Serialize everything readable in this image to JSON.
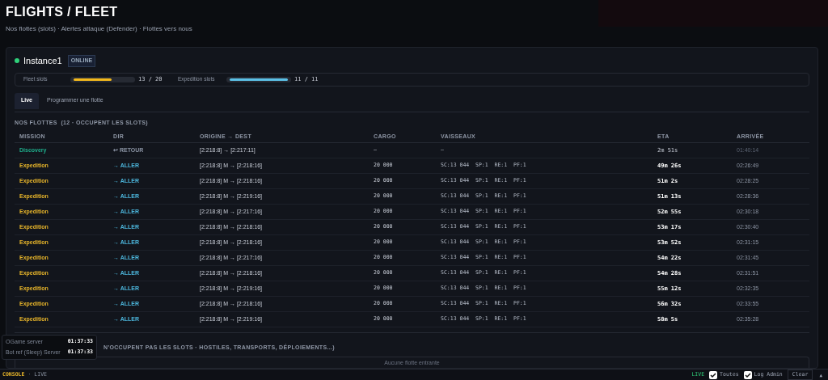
{
  "page": {
    "title": "FLIGHTS / FLEET",
    "subtitle": "Nos flottes (slots) · Alertes attaque (Defender) · Flottes vers nous"
  },
  "instance": {
    "name": "Instance1",
    "status": "ONLINE",
    "online": true
  },
  "slots": [
    {
      "label": "Fleet slots",
      "level": 0.65,
      "reading": "13 / 20",
      "kind": "fleet"
    },
    {
      "label": "Expedition slots",
      "level": 1,
      "reading": "11 / 11",
      "kind": "expedition"
    }
  ],
  "tabs": [
    {
      "label": "Live",
      "selected": true
    },
    {
      "label": "Programmer une flotte",
      "selected": false
    }
  ],
  "fleets": {
    "heading": "NOS FLOTTES  (12 · OCCUPENT LES SLOTS)",
    "columns": [
      "MISSION",
      "DIR",
      "ORIGINE → DEST",
      "CARGO",
      "VAISSEAUX",
      "ETA",
      "ARRIVÉE"
    ],
    "rows": [
      {
        "kind": "discovery",
        "mission": "Discovery",
        "dir": "↩ RETOUR",
        "route": "[2:218:8] → [2:217:11]",
        "cargo": "—",
        "ships": "—",
        "eta": "2m 51s",
        "arrival": "01:40:14"
      },
      {
        "kind": "expedition",
        "mission": "Expedition",
        "dir": "→ ALLER",
        "route": "[2:218:8] M → [2:218:16]",
        "cargo": "20 000",
        "ships": "SC:13 044  SP:1  RE:1  PF:1",
        "eta": "49m 26s",
        "arrival": "02:26:49"
      },
      {
        "kind": "expedition",
        "mission": "Expedition",
        "dir": "→ ALLER",
        "route": "[2:218:8] M → [2:218:16]",
        "cargo": "20 000",
        "ships": "SC:13 044  SP:1  RE:1  PF:1",
        "eta": "51m 2s",
        "arrival": "02:28:25"
      },
      {
        "kind": "expedition",
        "mission": "Expedition",
        "dir": "→ ALLER",
        "route": "[2:218:8] M → [2:219:16]",
        "cargo": "20 000",
        "ships": "SC:13 044  SP:1  RE:1  PF:1",
        "eta": "51m 13s",
        "arrival": "02:28:36"
      },
      {
        "kind": "expedition",
        "mission": "Expedition",
        "dir": "→ ALLER",
        "route": "[2:218:8] M → [2:217:16]",
        "cargo": "20 000",
        "ships": "SC:13 044  SP:1  RE:1  PF:1",
        "eta": "52m 55s",
        "arrival": "02:30:18"
      },
      {
        "kind": "expedition",
        "mission": "Expedition",
        "dir": "→ ALLER",
        "route": "[2:218:8] M → [2:218:16]",
        "cargo": "20 000",
        "ships": "SC:13 044  SP:1  RE:1  PF:1",
        "eta": "53m 17s",
        "arrival": "02:30:40"
      },
      {
        "kind": "expedition",
        "mission": "Expedition",
        "dir": "→ ALLER",
        "route": "[2:218:8] M → [2:218:16]",
        "cargo": "20 000",
        "ships": "SC:13 044  SP:1  RE:1  PF:1",
        "eta": "53m 52s",
        "arrival": "02:31:15"
      },
      {
        "kind": "expedition",
        "mission": "Expedition",
        "dir": "→ ALLER",
        "route": "[2:218:8] M → [2:217:16]",
        "cargo": "20 000",
        "ships": "SC:13 044  SP:1  RE:1  PF:1",
        "eta": "54m 22s",
        "arrival": "02:31:45"
      },
      {
        "kind": "expedition",
        "mission": "Expedition",
        "dir": "→ ALLER",
        "route": "[2:218:8] M → [2:218:16]",
        "cargo": "20 000",
        "ships": "SC:13 044  SP:1  RE:1  PF:1",
        "eta": "54m 28s",
        "arrival": "02:31:51"
      },
      {
        "kind": "expedition",
        "mission": "Expedition",
        "dir": "→ ALLER",
        "route": "[2:218:8] M → [2:219:16]",
        "cargo": "20 000",
        "ships": "SC:13 044  SP:1  RE:1  PF:1",
        "eta": "55m 12s",
        "arrival": "02:32:35"
      },
      {
        "kind": "expedition",
        "mission": "Expedition",
        "dir": "→ ALLER",
        "route": "[2:218:8] M → [2:218:16]",
        "cargo": "20 000",
        "ships": "SC:13 044  SP:1  RE:1  PF:1",
        "eta": "56m 32s",
        "arrival": "02:33:55"
      },
      {
        "kind": "expedition",
        "mission": "Expedition",
        "dir": "→ ALLER",
        "route": "[2:218:8] M → [2:219:16]",
        "cargo": "20 000",
        "ships": "SC:13 044  SP:1  RE:1  PF:1",
        "eta": "58m 5s",
        "arrival": "02:35:28"
      }
    ]
  },
  "other": {
    "heading": "N'OCCUPENT PAS LES SLOTS · HOSTILES, TRANSPORTS, DÉPLOIEMENTS...)",
    "empty": "Aucune flotte entrante"
  },
  "clocks": [
    {
      "label": "OGame server",
      "time": "01:37:33"
    },
    {
      "label": "Bot ref (Sleep) Server",
      "time": "01:37:33"
    }
  ],
  "console": {
    "title": "CONSOLE",
    "separator": "·",
    "mode": "LIVE",
    "live": "LIVE",
    "filters": [
      {
        "label": "Toutes",
        "checked": true
      },
      {
        "label": "Log Admin",
        "checked": true
      }
    ],
    "clear": "Clear",
    "toggle": "▲"
  }
}
